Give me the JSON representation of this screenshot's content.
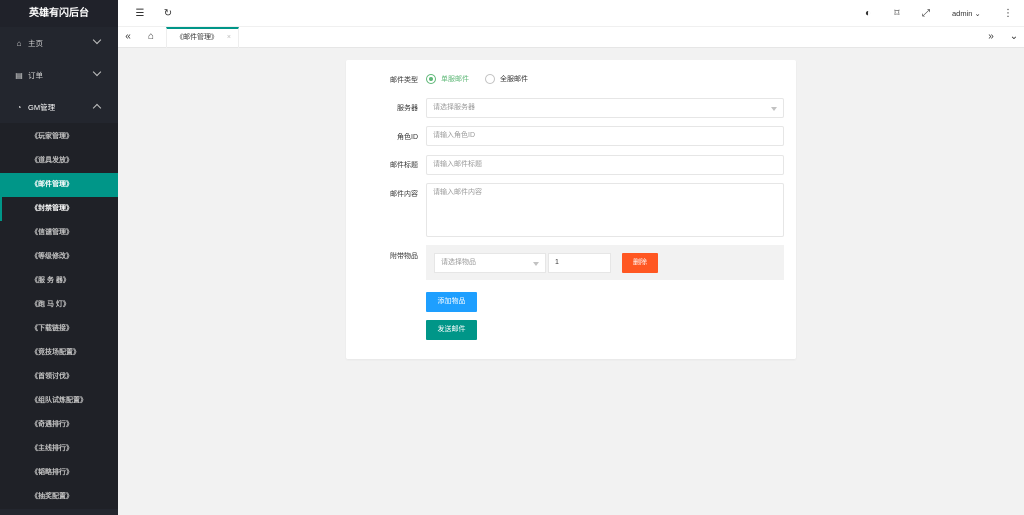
{
  "app": {
    "title": "英雄有闪后台"
  },
  "sidebar": {
    "home": {
      "label": "主页"
    },
    "orders": {
      "label": "订单"
    },
    "gm": {
      "label": "GM管理"
    },
    "items": [
      {
        "label": "《玩家管理》"
      },
      {
        "label": "《道具发放》"
      },
      {
        "label": "《邮件管理》"
      },
      {
        "label": "《封禁管理》"
      },
      {
        "label": "《信谴管理》"
      },
      {
        "label": "《等级修改》"
      },
      {
        "label": "《服 务 器》"
      },
      {
        "label": "《跑 马 灯》"
      },
      {
        "label": "《下载链接》"
      },
      {
        "label": "《竞技场配置》"
      },
      {
        "label": "《首领讨伐》"
      },
      {
        "label": "《组队试炼配置》"
      },
      {
        "label": "《奇遇排行》"
      },
      {
        "label": "《主线排行》"
      },
      {
        "label": "《韬略排行》"
      },
      {
        "label": "《抽奖配置》"
      }
    ]
  },
  "header": {
    "user": "admin"
  },
  "tabs": {
    "active": "《邮件管理》",
    "close": "×"
  },
  "form": {
    "mail_type_label": "邮件类型",
    "mail_type_options": [
      "单服邮件",
      "全服邮件"
    ],
    "server_label": "服务器",
    "server_placeholder": "请选择服务器",
    "role_label": "角色ID",
    "role_placeholder": "请输入角色ID",
    "title_label": "邮件标题",
    "title_placeholder": "请输入邮件标题",
    "content_label": "邮件内容",
    "content_placeholder": "请输入邮件内容",
    "attach_label": "附带物品",
    "item_placeholder": "请选择物品",
    "qty_value": "1",
    "delete_label": "删除",
    "add_label": "添加物品",
    "send_label": "发送邮件"
  }
}
